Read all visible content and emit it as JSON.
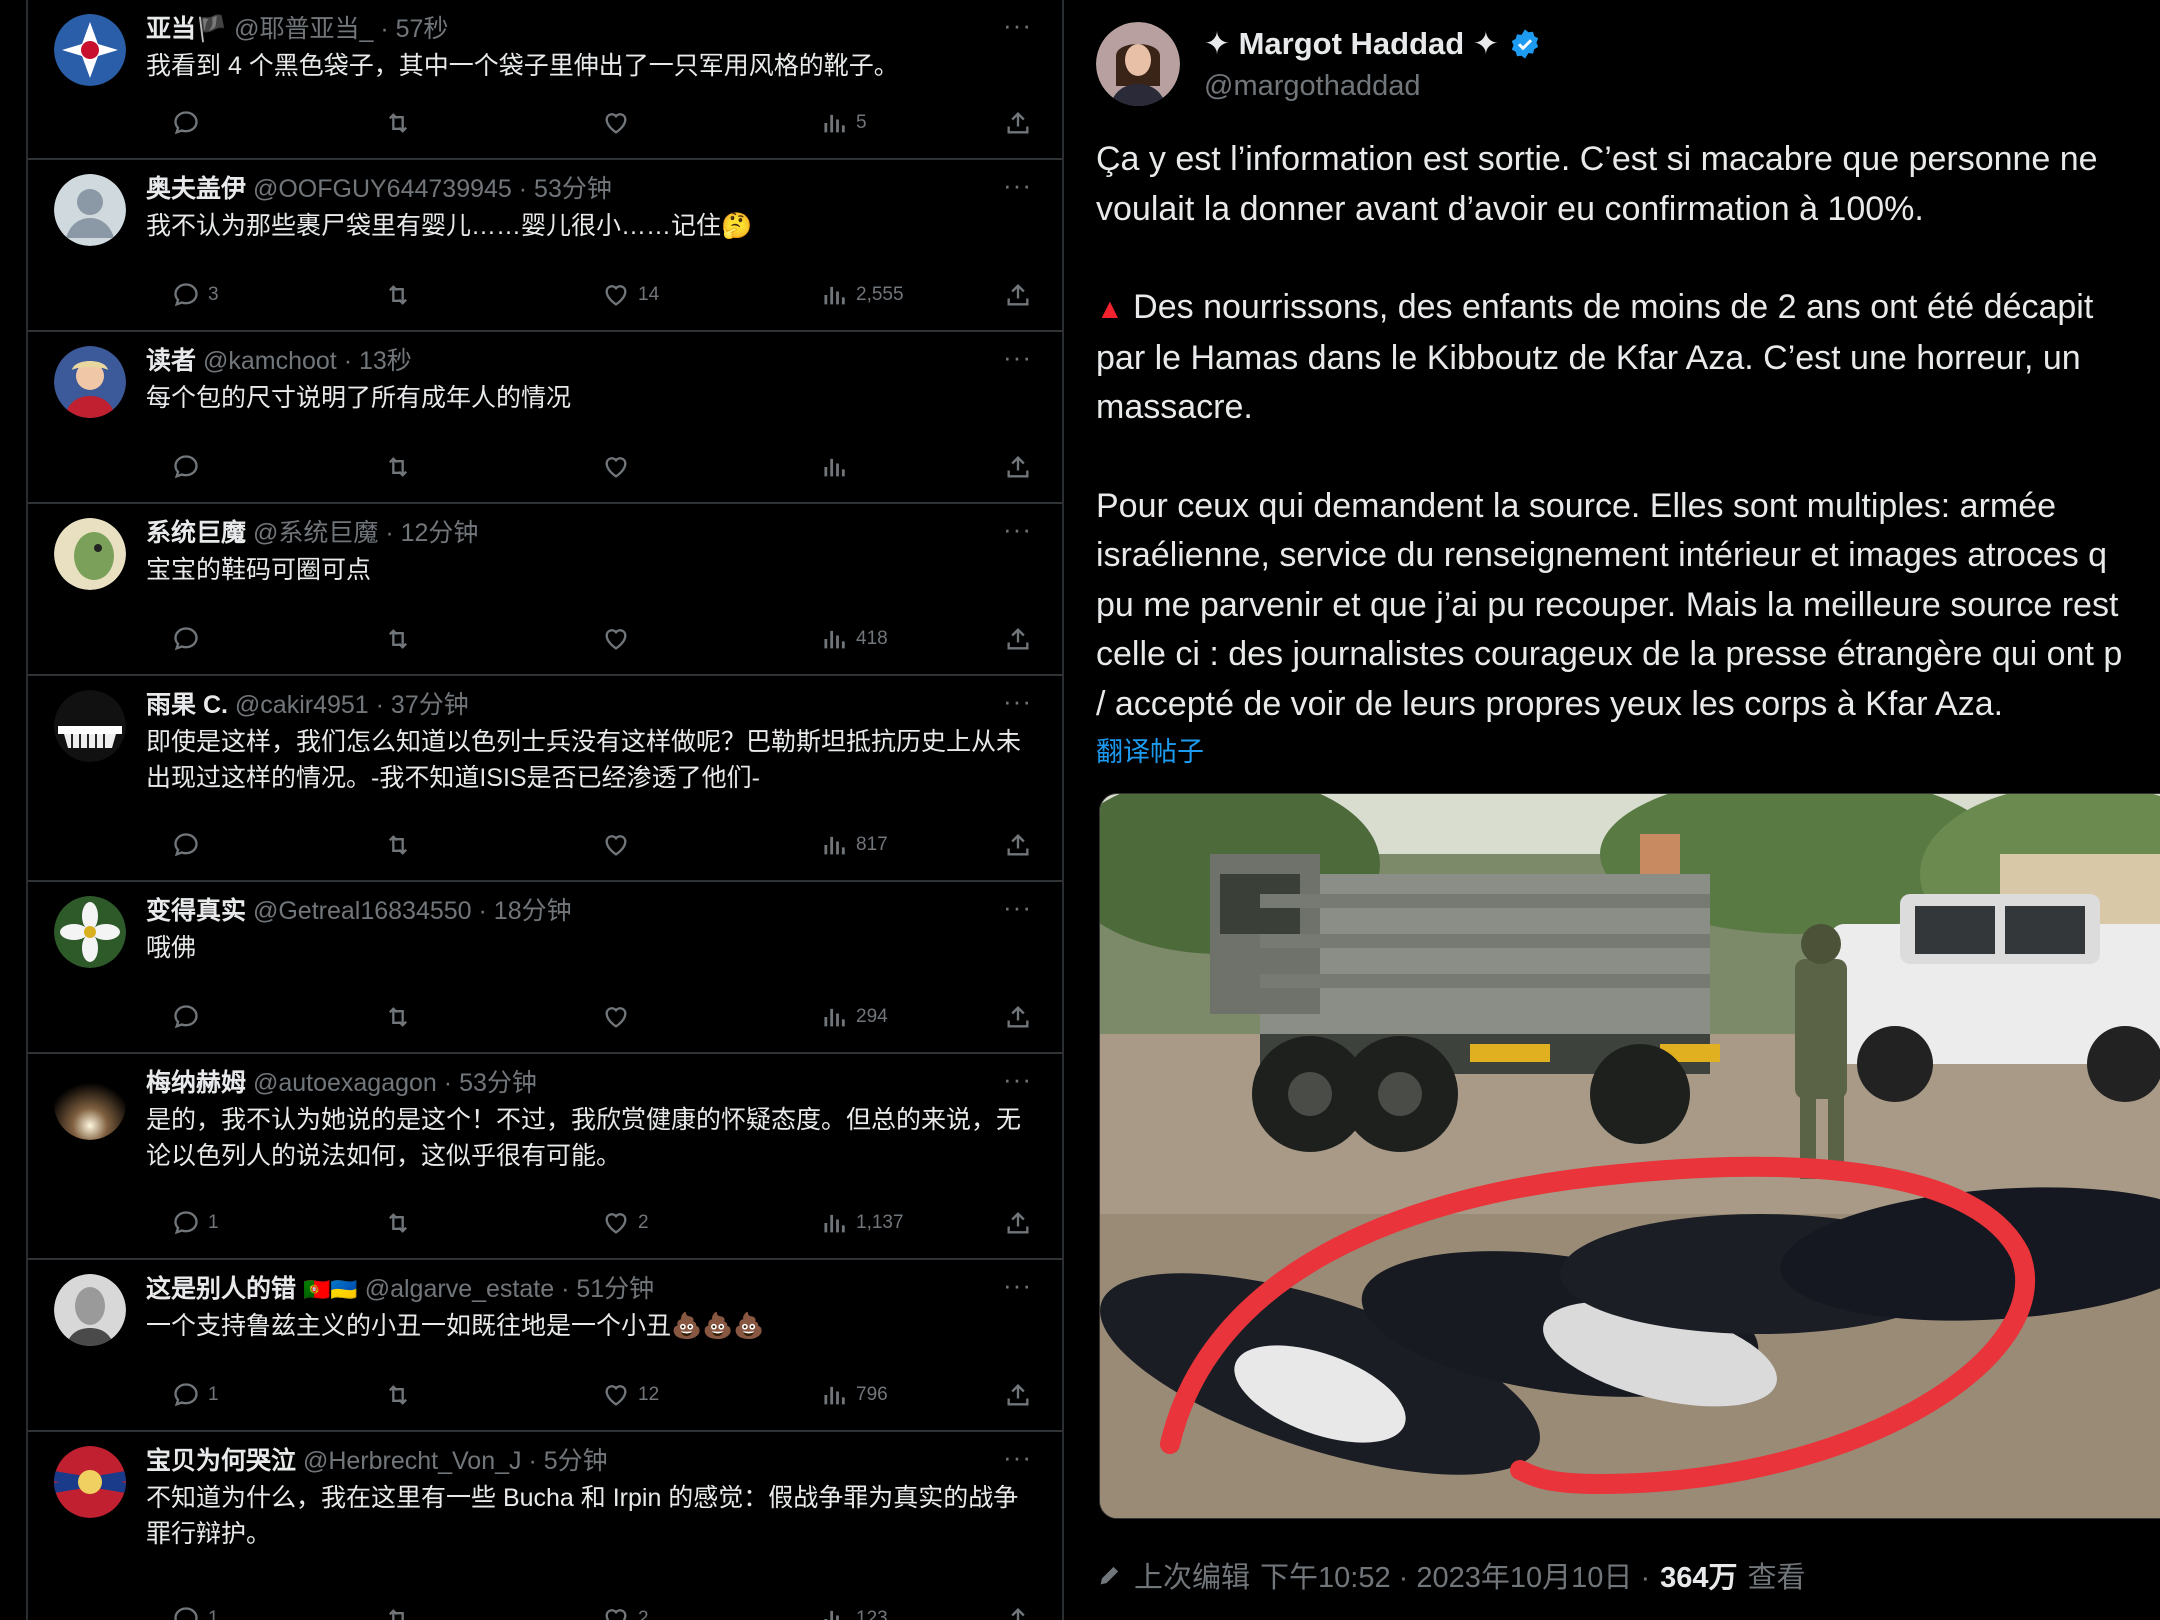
{
  "replies": [
    {
      "name": "亚当🏴",
      "handle": "@耶普亚当_",
      "time": "· 57秒",
      "text": "我看到 4 个黑色袋子，其中一个袋子里伸出了一只军用风格的靴子。",
      "replies": "",
      "likes": "",
      "views": "5"
    },
    {
      "name": "奥夫盖伊",
      "handle": "@OOFGUY644739945",
      "time": "· 53分钟",
      "text": "我不认为那些裹尸袋里有婴儿……婴儿很小……记住🤔",
      "replies": "3",
      "likes": "14",
      "views": "2,555"
    },
    {
      "name": "读者",
      "handle": "@kamchoot",
      "time": "· 13秒",
      "text": "每个包的尺寸说明了所有成年人的情况",
      "replies": "",
      "likes": "",
      "views": ""
    },
    {
      "name": "系统巨魔",
      "handle": "@系统巨魔",
      "time": "· 12分钟",
      "text": "宝宝的鞋码可圈可点",
      "replies": "",
      "likes": "",
      "views": "418"
    },
    {
      "name": "雨果 C.",
      "handle": "@cakir4951",
      "time": "· 37分钟",
      "text": "即使是这样，我们怎么知道以色列士兵没有这样做呢？巴勒斯坦抵抗历史上从未出现过这样的情况。-我不知道ISIS是否已经渗透了他们-",
      "replies": "",
      "likes": "",
      "views": "817"
    },
    {
      "name": "变得真实",
      "handle": "@Getreal16834550",
      "time": "· 18分钟",
      "text": "哦佛",
      "replies": "",
      "likes": "",
      "views": "294"
    },
    {
      "name": "梅纳赫姆",
      "handle": "@autoexagagon",
      "time": "· 53分钟",
      "text": "是的，我不认为她说的是这个！不过，我欣赏健康的怀疑态度。但总的来说，无论以色列人的说法如何，这似乎很有可能。",
      "replies": "1",
      "likes": "2",
      "views": "1,137"
    },
    {
      "name": "这是别人的错",
      "flags": "🇵🇹🇺🇦",
      "handle": "@algarve_estate",
      "time": "· 51分钟",
      "text": "一个支持鲁兹主义的小丑一如既往地是一个小丑💩💩💩",
      "replies": "1",
      "likes": "12",
      "views": "796"
    },
    {
      "name": "宝贝为何哭泣",
      "handle": "@Herbrecht_Von_J",
      "time": "· 5分钟",
      "text": "不知道为什么，我在这里有一些 Bucha 和 Irpin 的感觉：假战争罪为真实的战争罪行辩护。",
      "replies": "1",
      "likes": "2",
      "views": "123"
    }
  ],
  "main_post": {
    "name": "✦ Margot Haddad ✦",
    "handle": "@margothaddad",
    "para1_line1": "Ça y est l’information est sortie. C’est si macabre que personne ne",
    "para1_line2": "voulait la donner avant d’avoir eu confirmation à 100%.",
    "para2_line1": "▲",
    "para2_line1_text": " Des nourrissons, des enfants de moins de 2 ans ont été décapit",
    "para2_line2": "par le Hamas dans le Kibboutz de Kfar Aza. C’est une horreur, un",
    "para2_line3": "massacre.",
    "para3_line1": "Pour ceux qui demandent la source. Elles sont multiples: armée",
    "para3_line2": "israélienne, service du renseignement intérieur et images atroces q",
    "para3_line3": "pu me parvenir et que j’ai pu recouper. Mais la meilleure source rest",
    "para3_line4": "celle ci : des journalistes courageux de la presse étrangère qui ont p",
    "para3_line5": "/ accepté de voir de leurs propres yeux les corps à Kfar Aza.",
    "translate_label": "翻译帖子",
    "footer_edit": "上次编辑",
    "footer_time": "下午10:52 · 2023年10月10日 ·",
    "footer_views": "364万",
    "footer_views_label": "查看"
  },
  "colors": {
    "accent": "#1d9bf0",
    "muted": "#71767b",
    "divider": "#2f3336",
    "annotation_circle": "#e8343a"
  },
  "icons": [
    "reply-icon",
    "retweet-icon",
    "like-icon",
    "views-icon",
    "share-icon",
    "more-icon",
    "verified-icon",
    "pencil-icon"
  ]
}
